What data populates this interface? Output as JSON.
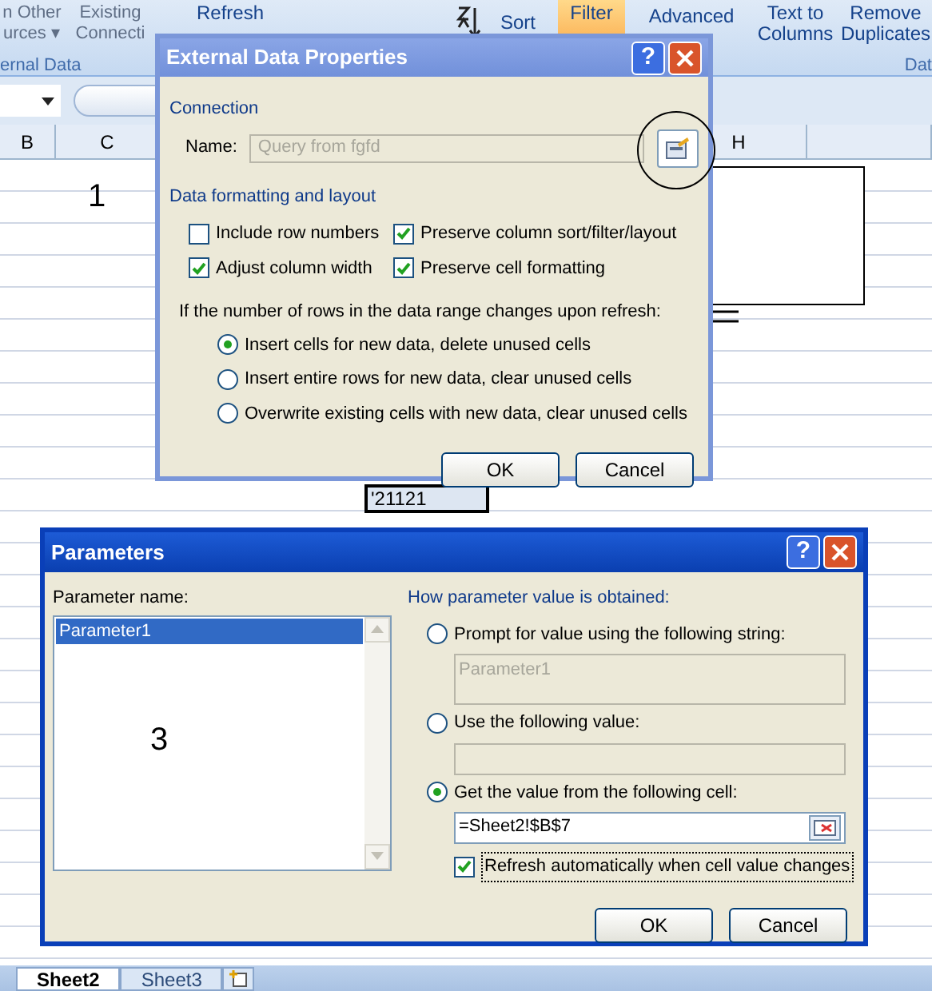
{
  "ribbon": {
    "buttons": [
      {
        "lines": [
          "n Other",
          "urces ▾"
        ],
        "kind": "large"
      },
      {
        "lines": [
          "Existing",
          "Connecti"
        ],
        "kind": "large"
      },
      {
        "lines": [
          "Refresh"
        ],
        "kind": "large"
      },
      {
        "lines": [
          "Sort"
        ],
        "kind": "sort"
      },
      {
        "lines": [
          "Filter"
        ],
        "kind": "large",
        "selected": true
      },
      {
        "lines": [
          "Advanced"
        ],
        "kind": "small"
      },
      {
        "lines": [
          "Text to",
          "Columns"
        ],
        "kind": "large"
      },
      {
        "lines": [
          "Remove",
          "Duplicates"
        ],
        "kind": "large"
      }
    ],
    "group_labels": [
      "ernal Data",
      "Dat"
    ]
  },
  "sheet": {
    "columns": [
      "B",
      "C",
      "H"
    ],
    "annotation": "1",
    "cell_value": "'21121",
    "tabs": [
      {
        "label": "Sheet2",
        "selected": true
      },
      {
        "label": "Sheet3",
        "selected": false
      }
    ]
  },
  "external_data_dialog": {
    "title": "External Data Properties",
    "help": "?",
    "connection_label": "Connection",
    "name_label": "Name:",
    "name_value": "Query from fgfd",
    "layout_label": "Data formatting and layout",
    "checkboxes": [
      {
        "label": "Include row numbers",
        "checked": false
      },
      {
        "label": "Preserve column sort/filter/layout",
        "checked": true
      },
      {
        "label": "Adjust column width",
        "checked": true
      },
      {
        "label": "Preserve cell formatting",
        "checked": true
      }
    ],
    "prompt": "If the number of rows in the data range changes upon refresh:",
    "options": [
      {
        "label": "Insert cells for new data, delete unused cells",
        "selected": true
      },
      {
        "label": "Insert entire rows for new data, clear unused cells",
        "selected": false
      },
      {
        "label": "Overwrite existing cells with new data, clear unused cells",
        "selected": false
      }
    ],
    "buttons": [
      "OK",
      "Cancel"
    ]
  },
  "parameters_dialog": {
    "title": "Parameters",
    "help": "?",
    "list_label": "Parameter name:",
    "items": [
      {
        "label": "Parameter1",
        "selected": true
      }
    ],
    "annotation": "3",
    "group_label": "How parameter value is obtained:",
    "options": [
      {
        "label": "Prompt for value using the following string:",
        "selected": false,
        "field": "Parameter1",
        "field_disabled": true
      },
      {
        "label": "Use the following value:",
        "selected": false,
        "field_disabled": true
      },
      {
        "label": "Get the value from the following cell:",
        "selected": true,
        "field": "=Sheet2!$B$7",
        "field_disabled": false
      }
    ],
    "refresh": {
      "label": "Refresh automatically when cell value changes",
      "checked": true
    },
    "buttons": [
      "OK",
      "Cancel"
    ]
  }
}
